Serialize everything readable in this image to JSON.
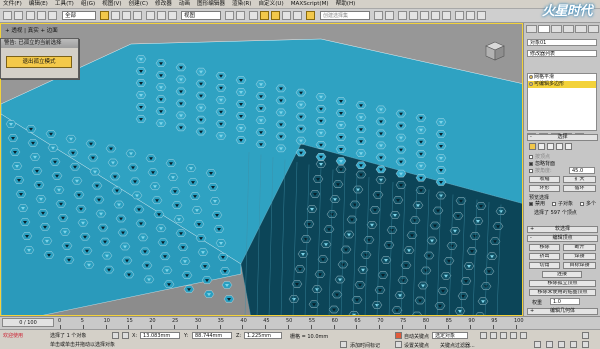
{
  "menu": [
    "文件(F)",
    "编辑(E)",
    "工具(T)",
    "组(G)",
    "视图(V)",
    "创建(C)",
    "修改器",
    "动画",
    "图形编辑器",
    "渲染(R)",
    "自定义(U)",
    "MAXScript(M)",
    "帮助(H)"
  ],
  "toolbar": {
    "filter_select": "全部",
    "view_select": "视图",
    "selection_set_placeholder": "创建选择集"
  },
  "watermark": "火星时代",
  "viewport": {
    "label": "+ 透视 | 真实 + 边面",
    "face_color": "#2fa2c2",
    "dark_color": "#0c4558"
  },
  "dialog": {
    "title": "警告: 已孤立的当前选择",
    "button": "退出孤立模式"
  },
  "panel": {
    "object_name": "对象01",
    "modifier_list": "修改器列表",
    "stack": [
      "网格平滑",
      "可编辑多边形"
    ],
    "rollouts": {
      "selection": "选择",
      "soft_selection": "软选择",
      "edit_vertices": "编辑顶点",
      "edit_geometry": "编辑几何体"
    },
    "selection_opts": [
      "按顶点",
      "忽略背面",
      "按角度:",
      "收缩",
      "扩大",
      "环形",
      "循环",
      "预览选择",
      "禁用",
      "子对象",
      "多个"
    ],
    "angle_value": "45.0",
    "selected_text": "选择了 597 个顶点",
    "buttons": [
      "移除",
      "断开",
      "挤出",
      "焊接",
      "切角",
      "目标焊接",
      "连接",
      "移除孤立顶点",
      "移除未使用的贴图顶点"
    ],
    "weight_label": "权重",
    "weight_value": "1.0"
  },
  "timeline": {
    "frame": "0 / 100",
    "ticks": [
      "0",
      "5",
      "10",
      "15",
      "20",
      "25",
      "30",
      "35",
      "40",
      "45",
      "50",
      "55",
      "60",
      "65",
      "70",
      "75",
      "80",
      "85",
      "90",
      "95",
      "100"
    ]
  },
  "status": {
    "welcome": "欢迎使用",
    "selected": "选择了 1 个对象",
    "hint": "单击或单击并拖动以选择对象",
    "x_label": "X:",
    "x_value": "13.083mm",
    "y_label": "Y:",
    "y_value": "88.744mm",
    "z_label": "Z:",
    "z_value": "1.225mm",
    "grid": "栅格 = 10.0mm",
    "add_time_tag": "添加时间标记",
    "auto_key": "自动关键点",
    "selected_obj": "选定对象",
    "set_key": "设置关键点",
    "key_filters": "关键点过滤器..."
  }
}
